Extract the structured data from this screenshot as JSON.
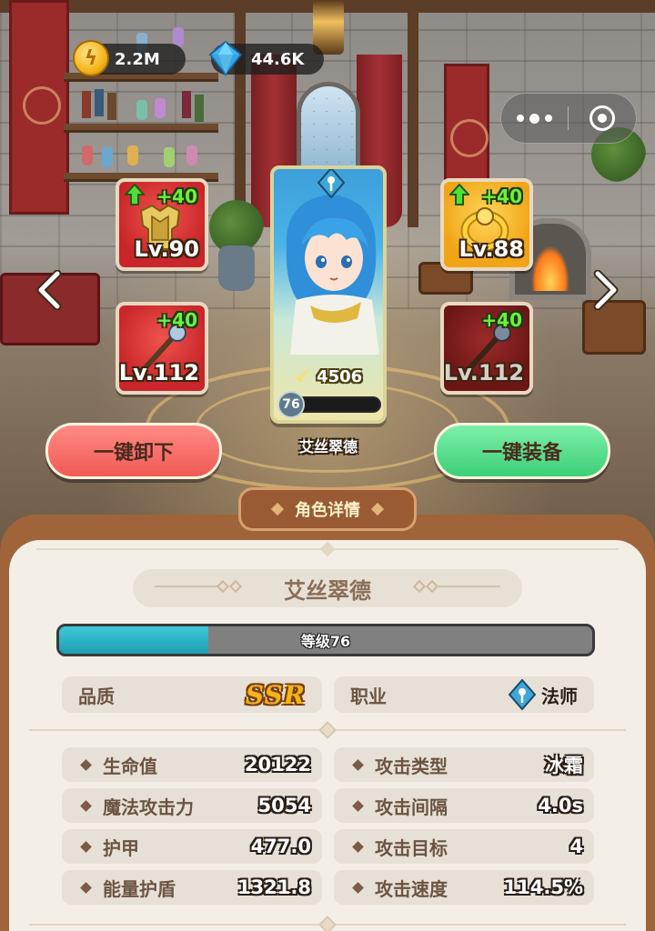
{
  "currencies": {
    "gold": {
      "icon": "gold-coin-icon",
      "value": "2.2M"
    },
    "gems": {
      "icon": "blue-gem-icon",
      "value": "44.6K"
    }
  },
  "equipment": {
    "armor": {
      "icon": "armor-icon",
      "bonus": "+40",
      "level": "Lv.90",
      "rarity_color": "#d7302e"
    },
    "ring": {
      "icon": "ring-icon",
      "bonus": "+40",
      "level": "Lv.88",
      "rarity_color": "#f0a416"
    },
    "staff_left": {
      "icon": "staff-icon",
      "bonus": "+40",
      "level": "Lv.112",
      "rarity_color": "#d7302e"
    },
    "staff_right": {
      "icon": "staff-icon",
      "bonus": "+40",
      "level": "Lv.112",
      "rarity_color": "#7a1c1c"
    }
  },
  "hero_card": {
    "power": "4506",
    "level": "76",
    "exp_fraction": 0.12,
    "name": "艾丝翠德"
  },
  "buttons": {
    "unequip_all": "一键卸下",
    "equip_all": "一键装备"
  },
  "details": {
    "tab_title": "角色详情",
    "name": "艾丝翠德",
    "level_text": "等级76",
    "level_fraction": 0.28,
    "quality_label": "品质",
    "quality_value": "SSR",
    "class_label": "职业",
    "class_value": "法师",
    "stats_left": [
      {
        "label": "生命值",
        "value": "20122"
      },
      {
        "label": "魔法攻击力",
        "value": "5054"
      },
      {
        "label": "护甲",
        "value": "477.0"
      },
      {
        "label": "能量护盾",
        "value": "1321.8"
      }
    ],
    "stats_right": [
      {
        "label": "攻击类型",
        "value": "冰霜"
      },
      {
        "label": "攻击间隔",
        "value": "4.0s"
      },
      {
        "label": "攻击目标",
        "value": "4"
      },
      {
        "label": "攻击速度",
        "value": "114.5%"
      }
    ]
  },
  "colors": {
    "panel_brown": "#a0643a",
    "panel_cream": "#f4efe6",
    "unequip_red": "#f05a55",
    "equip_green": "#3dcf78",
    "ssr_gold": "#f4b51a",
    "exp_blue": "#3ab0e8"
  }
}
